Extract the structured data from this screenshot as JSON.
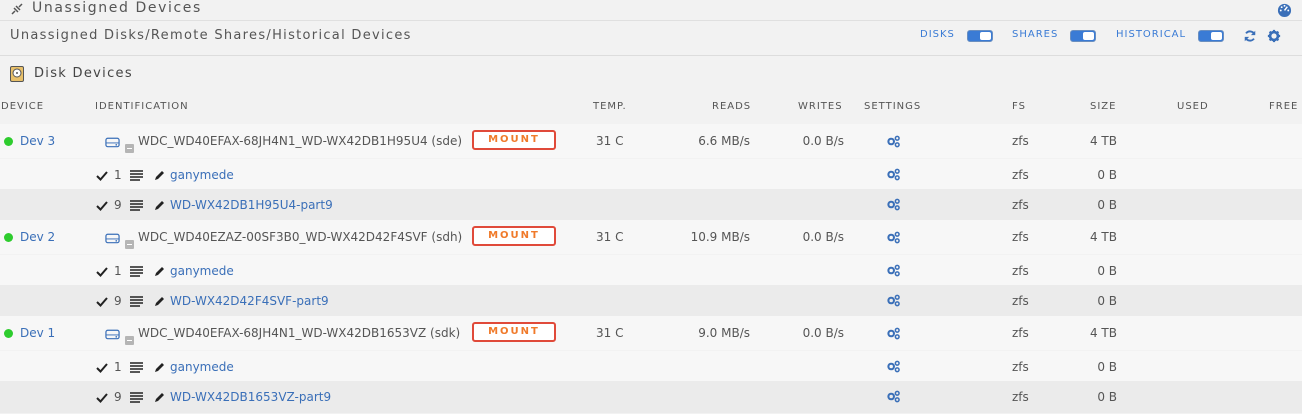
{
  "header": {
    "title": "Unassigned Devices",
    "subtitle": "Unassigned Disks/Remote Shares/Historical Devices",
    "toggles": [
      {
        "label": "DISKS",
        "on": true
      },
      {
        "label": "SHARES",
        "on": true
      },
      {
        "label": "HISTORICAL",
        "on": true
      }
    ]
  },
  "section": {
    "label": "Disk Devices"
  },
  "columns": {
    "device": "DEVICE",
    "identification": "IDENTIFICATION",
    "temp": "TEMP.",
    "reads": "READS",
    "writes": "WRITES",
    "settings": "SETTINGS",
    "fs": "FS",
    "size": "SIZE",
    "used": "USED",
    "free": "FREE"
  },
  "disks": [
    {
      "device": "Dev 3",
      "identification": "WDC_WD40EFAX-68JH4N1_WD-WX42DB1H95U4 (sde)",
      "action": "MOUNT",
      "temp": "31 C",
      "reads": "6.6 MB/s",
      "writes": "0.0 B/s",
      "fs": "zfs",
      "size": "4 TB",
      "partitions": [
        {
          "num": "1",
          "name": "ganymede",
          "fs": "zfs",
          "size": "0 B"
        },
        {
          "num": "9",
          "name": "WD-WX42DB1H95U4-part9",
          "fs": "zfs",
          "size": "0 B"
        }
      ]
    },
    {
      "device": "Dev 2",
      "identification": "WDC_WD40EZAZ-00SF3B0_WD-WX42D42F4SVF (sdh)",
      "action": "MOUNT",
      "temp": "31 C",
      "reads": "10.9 MB/s",
      "writes": "0.0 B/s",
      "fs": "zfs",
      "size": "4 TB",
      "partitions": [
        {
          "num": "1",
          "name": "ganymede",
          "fs": "zfs",
          "size": "0 B"
        },
        {
          "num": "9",
          "name": "WD-WX42D42F4SVF-part9",
          "fs": "zfs",
          "size": "0 B"
        }
      ]
    },
    {
      "device": "Dev 1",
      "identification": "WDC_WD40EFAX-68JH4N1_WD-WX42DB1653VZ (sdk)",
      "action": "MOUNT",
      "temp": "31 C",
      "reads": "9.0 MB/s",
      "writes": "0.0 B/s",
      "fs": "zfs",
      "size": "4 TB",
      "partitions": [
        {
          "num": "1",
          "name": "ganymede",
          "fs": "zfs",
          "size": "0 B"
        },
        {
          "num": "9",
          "name": "WD-WX42DB1653VZ-part9",
          "fs": "zfs",
          "size": "0 B"
        }
      ]
    }
  ],
  "colors": {
    "accent": "#3a7bd5",
    "online": "#2ecc2e",
    "mount_border": "#e04a3a",
    "mount_text": "#f07a2a"
  },
  "icons": [
    "plug-icon",
    "dashboard-icon",
    "refresh-icon",
    "gear-icon",
    "hdd-icon",
    "disk-icon",
    "collapse-icon",
    "settings-icon",
    "check-icon",
    "list-icon",
    "pencil-icon"
  ]
}
